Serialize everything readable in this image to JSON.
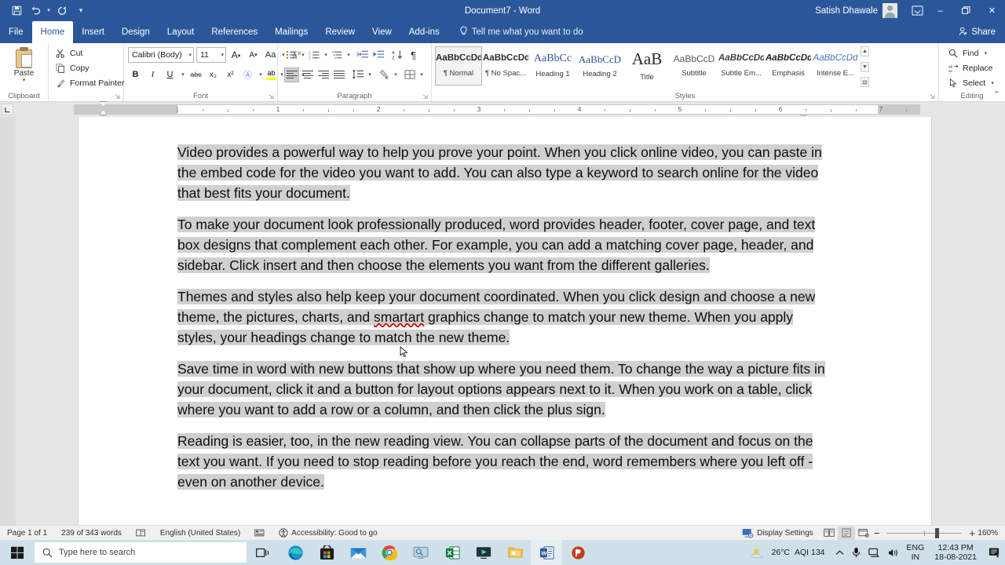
{
  "titlebar": {
    "quick_access": [
      {
        "name": "save-icon",
        "label": "Save"
      },
      {
        "name": "undo-icon",
        "label": "Undo"
      },
      {
        "name": "redo-icon",
        "label": "Redo"
      },
      {
        "name": "customize-quick-access-icon",
        "label": "Customize Quick Access Toolbar"
      }
    ],
    "document_title": "Document7  -  Word",
    "user_name": "Satish Dhawale",
    "ribbon_display_options": "Ribbon Display Options",
    "minimize": "–",
    "restore": "❐",
    "close": "✕"
  },
  "tabs": [
    {
      "label": "File",
      "active": false
    },
    {
      "label": "Home",
      "active": true
    },
    {
      "label": "Insert",
      "active": false
    },
    {
      "label": "Design",
      "active": false
    },
    {
      "label": "Layout",
      "active": false
    },
    {
      "label": "References",
      "active": false
    },
    {
      "label": "Mailings",
      "active": false
    },
    {
      "label": "Review",
      "active": false
    },
    {
      "label": "View",
      "active": false
    },
    {
      "label": "Add-ins",
      "active": false
    }
  ],
  "tell_me": "Tell me what you want to do",
  "share_label": "Share",
  "ribbon": {
    "clipboard": {
      "group_label": "Clipboard",
      "paste_label": "Paste",
      "cut_label": "Cut",
      "copy_label": "Copy",
      "format_painter_label": "Format Painter"
    },
    "font": {
      "group_label": "Font",
      "font_name": "Calibri (Body)",
      "font_size": "11",
      "grow_font": "A",
      "shrink_font": "A",
      "change_case": "Aa",
      "clear_formatting": "Ⓐ",
      "bold": "B",
      "italic": "I",
      "underline": "U",
      "strikethrough": "abc",
      "subscript": "x₂",
      "superscript": "x²",
      "text_effects": "A",
      "highlight_color": "ab",
      "font_color": "A",
      "highlight_swatch": "#ffff00",
      "font_color_swatch": "#c00000"
    },
    "paragraph": {
      "group_label": "Paragraph",
      "bullets": "bullets-icon",
      "numbering": "numbering-icon",
      "multilevel": "multilevel-list-icon",
      "decrease_indent": "decrease-indent-icon",
      "increase_indent": "increase-indent-icon",
      "sort": "sort-icon",
      "show_marks": "¶",
      "align_left": "align-left-icon",
      "align_center": "align-center-icon",
      "align_right": "align-right-icon",
      "justify": "justify-icon",
      "line_spacing": "line-spacing-icon",
      "shading": "shading-icon",
      "borders": "borders-icon"
    },
    "styles": {
      "group_label": "Styles",
      "items": [
        {
          "preview": "AaBbCcDd",
          "name": "¶ Normal",
          "selected": true,
          "cls": "sp-norm"
        },
        {
          "preview": "AaBbCcDd",
          "name": "¶ No Spac...",
          "selected": false,
          "cls": "sp-norm"
        },
        {
          "preview": "AaBbCc",
          "name": "Heading 1",
          "selected": false,
          "cls": "sp-h1"
        },
        {
          "preview": "AaBbCcD",
          "name": "Heading 2",
          "selected": false,
          "cls": "sp-h2"
        },
        {
          "preview": "AaB",
          "name": "Title",
          "selected": false,
          "cls": "sp-title"
        },
        {
          "preview": "AaBbCcD",
          "name": "Subtitle",
          "selected": false,
          "cls": "sp-sub"
        },
        {
          "preview": "AaBbCcDd",
          "name": "Subtle Em...",
          "selected": false,
          "cls": "sp-subem"
        },
        {
          "preview": "AaBbCcDd",
          "name": "Emphasis",
          "selected": false,
          "cls": "sp-emph"
        },
        {
          "preview": "AaBbCcDd",
          "name": "Intense E...",
          "selected": false,
          "cls": "sp-intense"
        }
      ]
    },
    "editing": {
      "group_label": "Editing",
      "find_label": "Find",
      "replace_label": "Replace",
      "select_label": "Select"
    }
  },
  "ruler": {
    "numbers": [
      "1",
      "2",
      "3",
      "4",
      "5",
      "6",
      "7"
    ],
    "left_indent_inches": 0.25,
    "right_indent_inches": 6.5
  },
  "document": {
    "paragraphs": [
      {
        "text": "Video provides a powerful way to help you prove your point. When you click online video, you can paste in the embed code for the video you want to add. You can also type a keyword to search online for the video that best fits your document.",
        "selected": true
      },
      {
        "text": "To make your document look professionally produced, word provides header, footer, cover page, and text box designs that complement each other. For example, you can add a matching cover page, header, and sidebar. Click insert and then choose the elements you want from the different galleries.",
        "selected": true
      },
      {
        "text": "Themes and styles also help keep your document coordinated. When you click design and choose a new theme, the pictures, charts, and smartart graphics change to match your new theme. When you apply styles, your headings change to match the new theme.",
        "selected": true,
        "misspelled": "smartart"
      },
      {
        "text": "Save time in word with new buttons that show up where you need them. To change the way a picture fits in your document, click it and a button for layout options appears next to it. When you work on a table, click where you want to add a row or a column, and then click the plus sign.",
        "selected": true
      },
      {
        "text": "Reading is easier, too, in the new reading view. You can collapse parts of the document and focus on the text you want. If you need to stop reading before you reach the end, word remembers where you left off - even on another device.",
        "selected": true
      }
    ]
  },
  "statusbar": {
    "page": "Page 1 of 1",
    "words": "239 of 343 words",
    "proofing_icon": "proofing-errors-icon",
    "language": "English (United States)",
    "macro_icon": "macro-recording-icon",
    "accessibility": "Accessibility: Good to go",
    "display_settings": "Display Settings",
    "views": [
      {
        "name": "read-mode-view",
        "active": false
      },
      {
        "name": "print-layout-view",
        "active": true
      },
      {
        "name": "web-layout-view",
        "active": false
      }
    ],
    "zoom_out": "−",
    "zoom_in": "+",
    "zoom_level": "160%"
  },
  "taskbar": {
    "start": "start-button",
    "search_placeholder": "Type here to search",
    "task_view": "task-view-button",
    "apps": [
      {
        "name": "microsoft-edge-icon",
        "open": false
      },
      {
        "name": "microsoft-store-icon",
        "open": false
      },
      {
        "name": "mail-icon",
        "open": false
      },
      {
        "name": "google-chrome-icon",
        "open": false
      },
      {
        "name": "remote-desktop-icon",
        "open": false
      },
      {
        "name": "microsoft-excel-icon",
        "open": false
      },
      {
        "name": "media-player-icon",
        "open": false
      },
      {
        "name": "file-explorer-icon",
        "open": false
      },
      {
        "name": "microsoft-word-icon",
        "open": true
      },
      {
        "name": "microsoft-powerpoint-icon",
        "open": false
      }
    ],
    "weather_temp": "26°C",
    "aqi": "AQI 134",
    "lang_line1": "ENG",
    "lang_line2": "IN",
    "time": "12:43 PM",
    "date": "18-08-2021",
    "notifications": "notification-center-icon"
  },
  "colors": {
    "word_blue": "#2b579a",
    "selection_gray": "#d0d0d0",
    "taskbar": "#cfe0e8"
  }
}
